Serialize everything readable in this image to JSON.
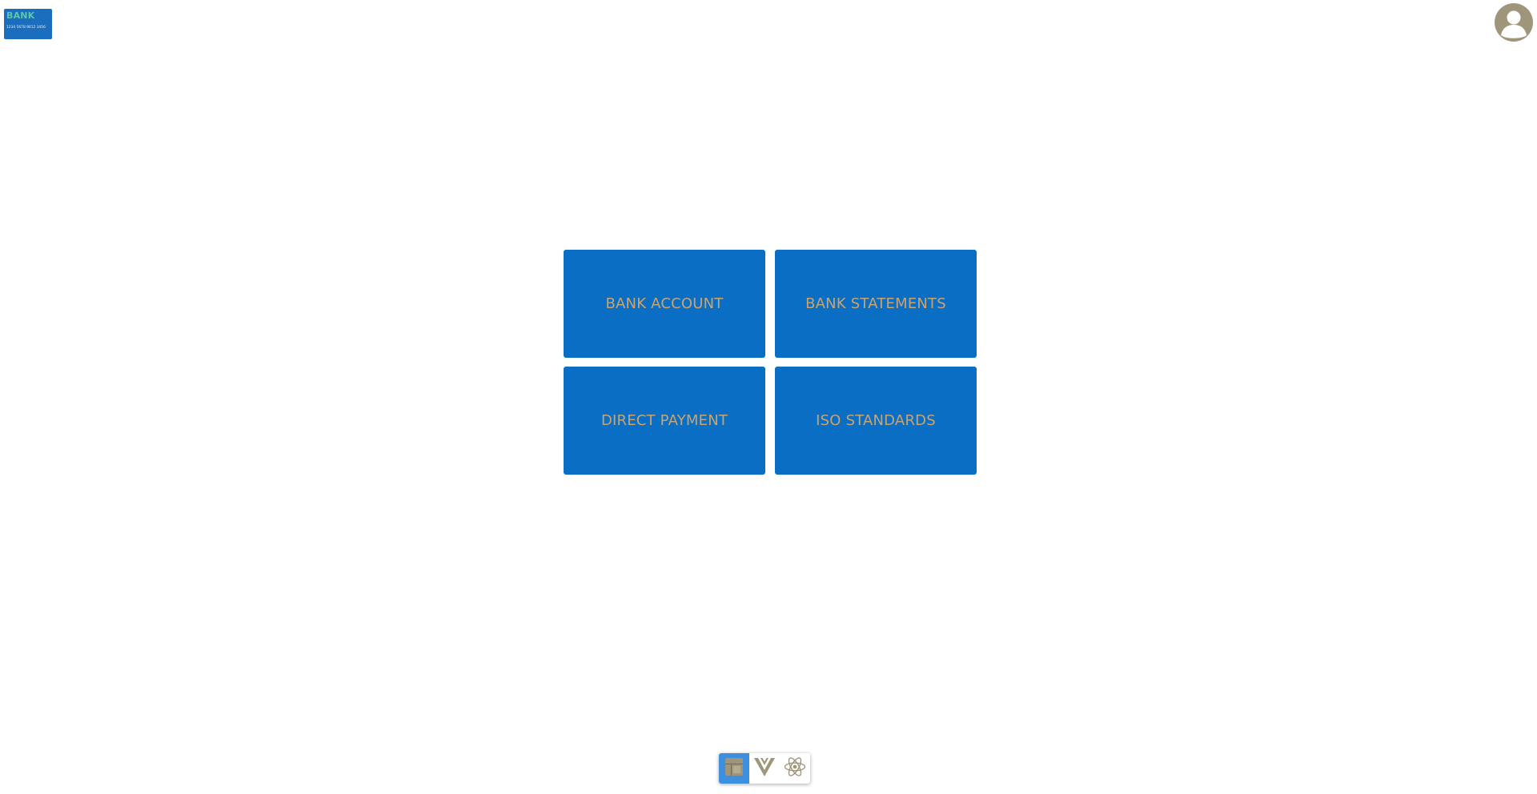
{
  "logo": {
    "title": "BANK",
    "card_number": "1234 5678 9012 3456"
  },
  "user": {
    "avatar_icon": "user-avatar-icon"
  },
  "tiles": [
    {
      "label": "BANK ACCOUNT"
    },
    {
      "label": "BANK STATEMENTS"
    },
    {
      "label": "DIRECT PAYMENT"
    },
    {
      "label": "ISO STANDARDS"
    }
  ],
  "dock": {
    "items": [
      {
        "icon": "app-grid-icon",
        "active": true
      },
      {
        "icon": "vue-logo-icon",
        "active": false
      },
      {
        "icon": "react-logo-icon",
        "active": false
      }
    ]
  },
  "colors": {
    "tile_background": "#0a6ec4",
    "tile_text": "#c9a46e",
    "logo_background": "#1a6ebd",
    "logo_title": "#5cc8a8",
    "avatar": "#9f957a",
    "dock_active": "#3d8fe0",
    "icon_tint": "#9f957a"
  }
}
